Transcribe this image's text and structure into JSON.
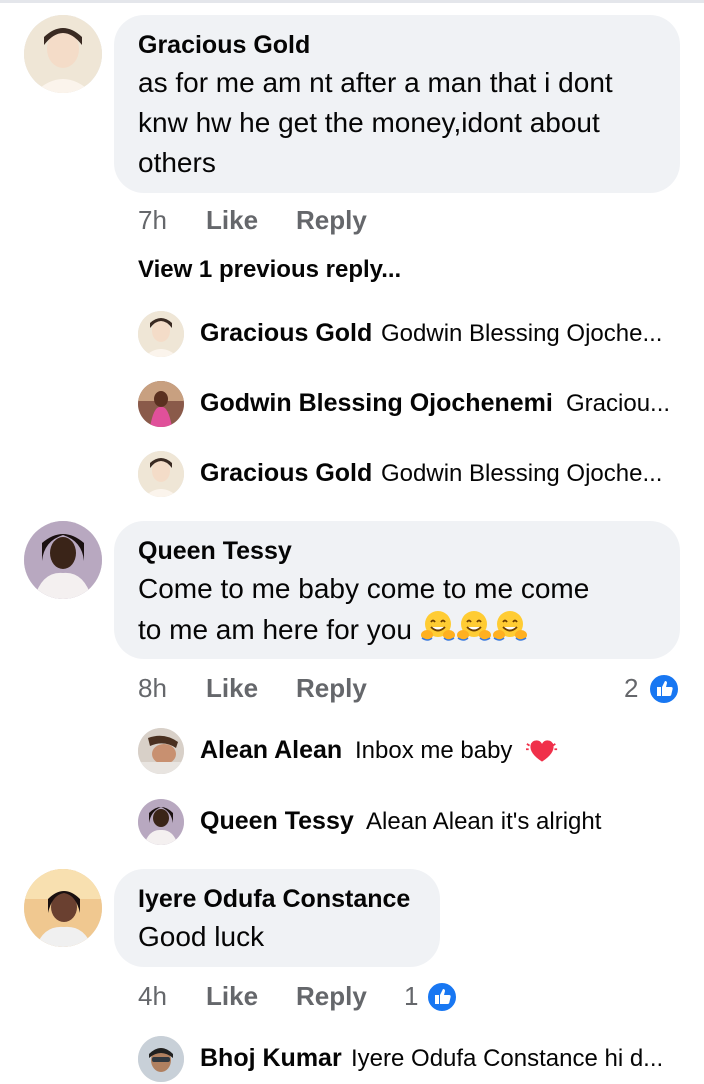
{
  "comments": [
    {
      "author": "Gracious Gold",
      "text": "as for me am nt after a man that i dont knw hw he get the money,idont about others",
      "time": "7h",
      "like_label": "Like",
      "reply_label": "Reply",
      "view_previous": "View 1 previous reply...",
      "replies": [
        {
          "author": "Gracious Gold",
          "text": "Godwin Blessing Ojoche..."
        },
        {
          "author": "Godwin Blessing Ojochenemi",
          "text": "Graciou..."
        },
        {
          "author": "Gracious Gold",
          "text": "Godwin Blessing Ojoche..."
        }
      ]
    },
    {
      "author": "Queen Tessy",
      "text_line1": "Come to me baby come to me come",
      "text_line2": "to me am here for you",
      "time": "8h",
      "like_label": "Like",
      "reply_label": "Reply",
      "reaction_count": "2",
      "replies": [
        {
          "author": "Alean Alean",
          "text": "Inbox me baby"
        },
        {
          "author": "Queen Tessy",
          "text": "Alean Alean it's alright"
        }
      ]
    },
    {
      "author": "Iyere Odufa Constance",
      "text": "Good luck",
      "time": "4h",
      "like_label": "Like",
      "reply_label": "Reply",
      "reaction_count": "1",
      "replies": [
        {
          "author": "Bhoj Kumar",
          "text": "Iyere Odufa Constance hi d..."
        }
      ]
    }
  ],
  "colors": {
    "bubble": "#f0f2f5",
    "meta": "#65676b",
    "like_blue": "#1877f2"
  },
  "icons": {
    "smiling_emoji": "smiling-face-with-open-hands-emoji",
    "heart_emoji": "beating-heart-emoji",
    "like": "thumbs-up-icon"
  }
}
